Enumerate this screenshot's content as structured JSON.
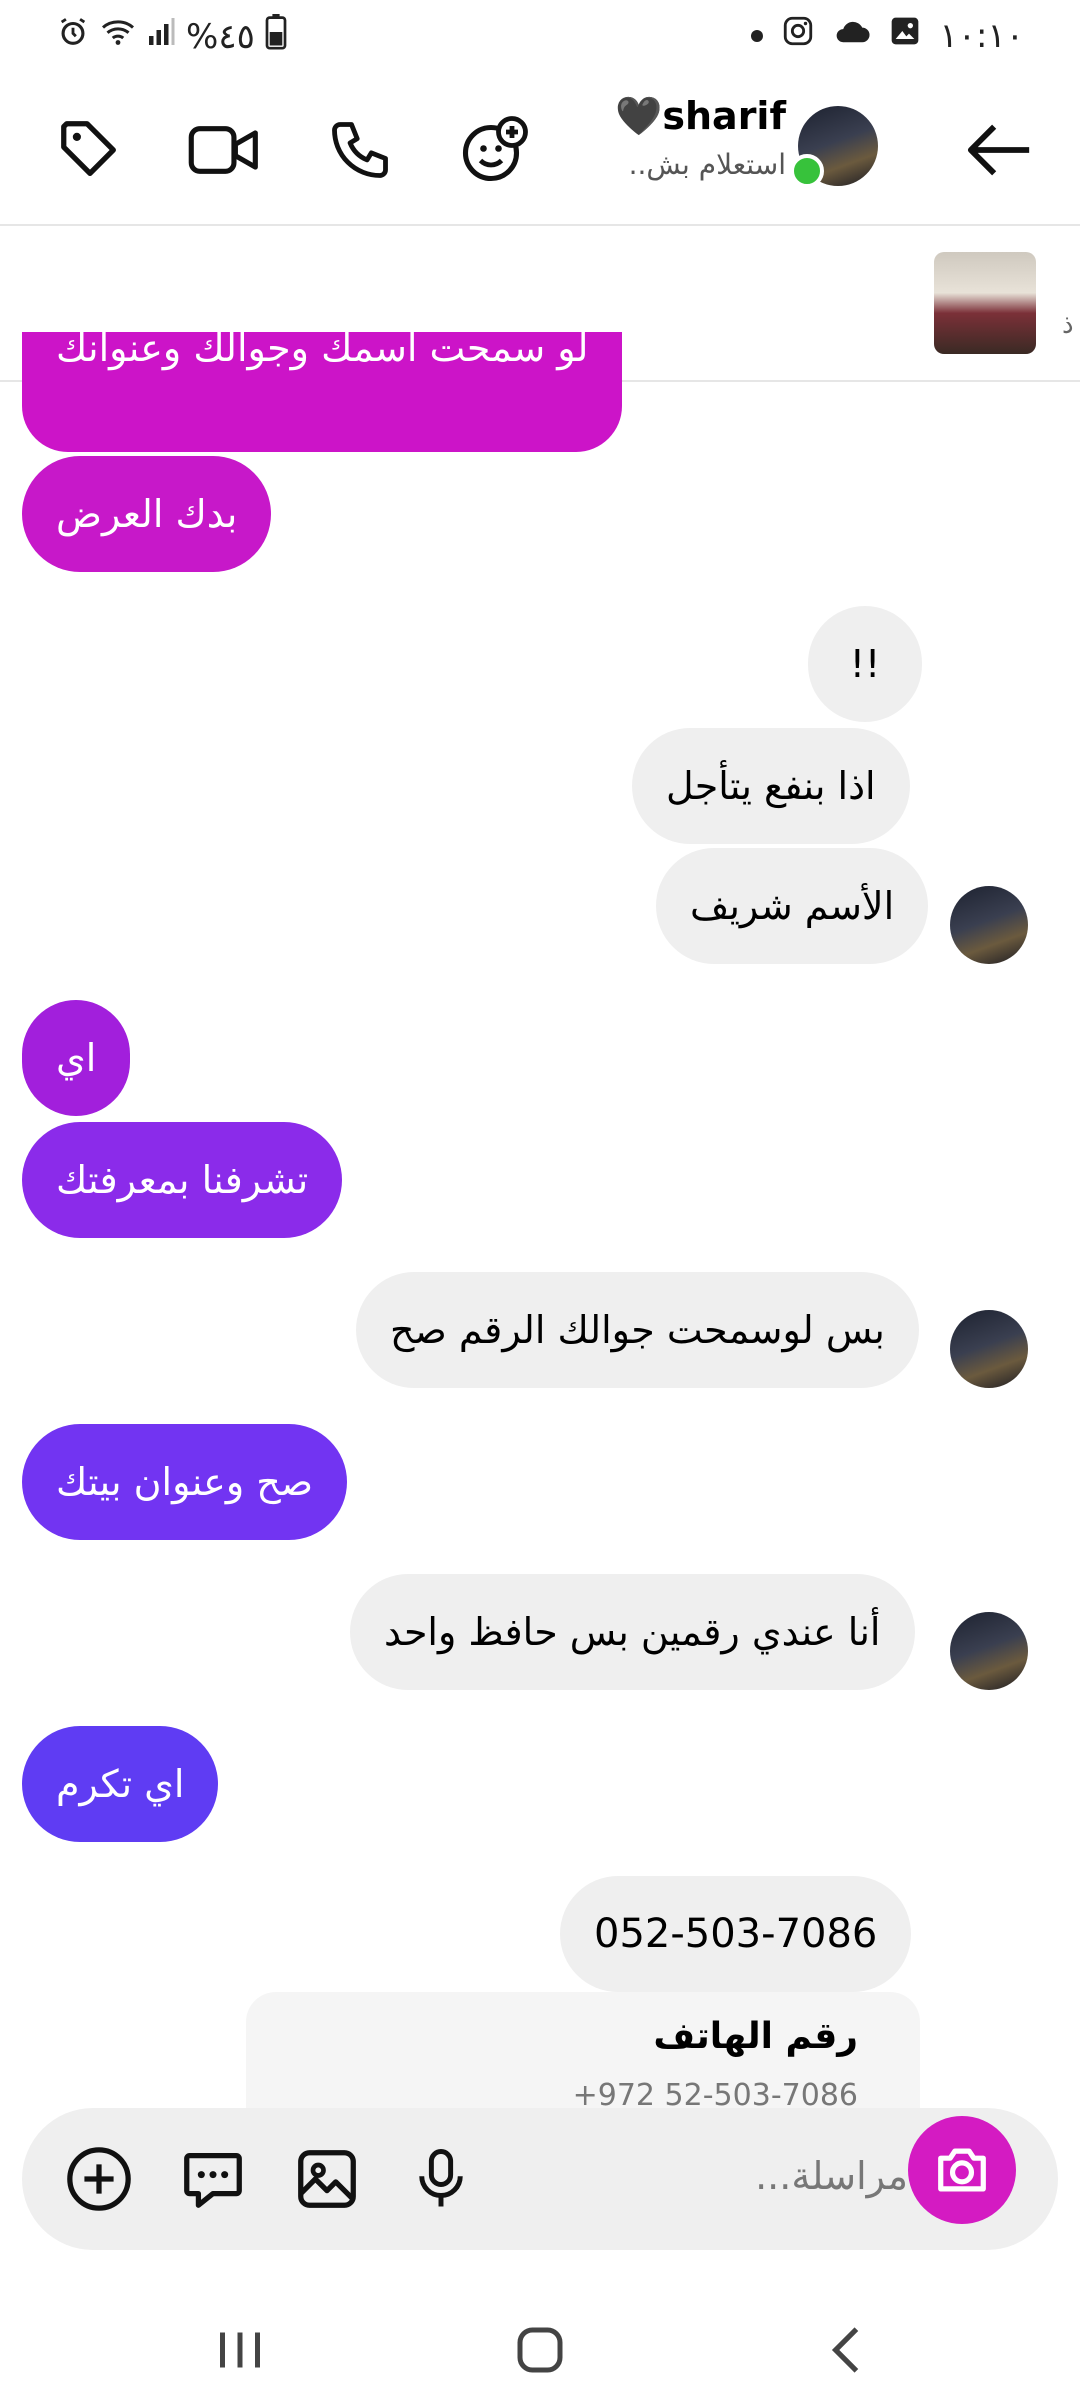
{
  "status_bar": {
    "battery": "%٤٥",
    "time": "١٠:١٠"
  },
  "header": {
    "contact_name": "sharif",
    "name_emoji": "🖤",
    "subtitle": "استعلام بش.."
  },
  "pinned": {
    "partial_text": "ذ"
  },
  "messages": [
    {
      "side": "out",
      "text": "لو سمحت اسمك وجوالك وعنوانك",
      "color": "#cc14c8"
    },
    {
      "side": "out",
      "text": "بدك العرض",
      "color": "#c718c9"
    },
    {
      "side": "in",
      "text": "!!"
    },
    {
      "side": "in",
      "text": "اذا بنفع يتأجل"
    },
    {
      "side": "in",
      "text": "الأسم شريف"
    },
    {
      "side": "out",
      "text": "اي",
      "color": "#a21fdc"
    },
    {
      "side": "out",
      "text": "تشرفنا بمعرفتك",
      "color": "#8b2bea"
    },
    {
      "side": "in",
      "text": "بس لوسمحت جوالك الرقم صح"
    },
    {
      "side": "out",
      "text": "صح وعنوان بيتك",
      "color": "#7234f2"
    },
    {
      "side": "in",
      "text": "أنا عندي رقمين بس حافظ واحد"
    },
    {
      "side": "out",
      "text": "اي تكرم",
      "color": "#5f3cf3"
    },
    {
      "side": "in",
      "text": "052-503-7086"
    }
  ],
  "contact_card": {
    "title": "رقم الهاتف",
    "number": "+972 52-503-7086"
  },
  "composer": {
    "placeholder": "مراسلة..."
  },
  "colors": {
    "camera_button": "#d41bc2",
    "online_dot": "#37c23b",
    "incoming_bubble": "#efefef"
  }
}
